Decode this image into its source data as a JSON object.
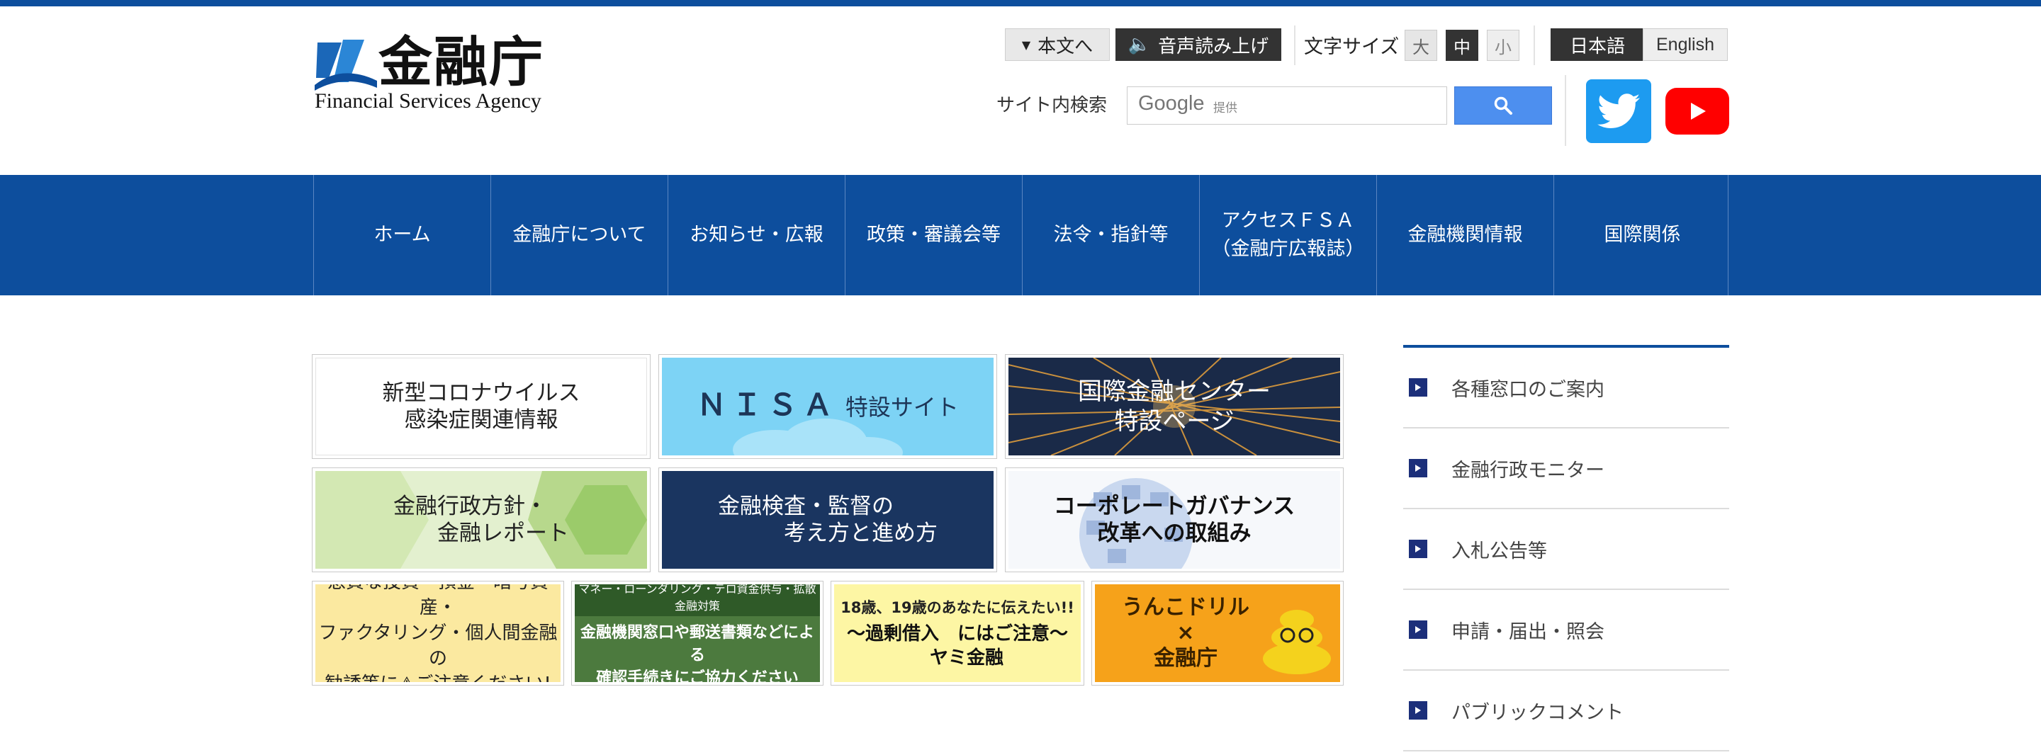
{
  "header": {
    "logo_jp": "金融庁",
    "logo_en": "Financial Services Agency",
    "honbun_label": "本文へ",
    "voice_label": "音声読み上げ",
    "font_size_label": "文字サイズ",
    "font_sizes": [
      "大",
      "中",
      "小"
    ],
    "lang_ja": "日本語",
    "lang_en": "English",
    "search_label": "サイト内検索",
    "search_provider": "Google",
    "search_provider_suffix": "提供"
  },
  "nav": [
    {
      "label": "ホーム"
    },
    {
      "label": "金融庁について"
    },
    {
      "label": "お知らせ・広報"
    },
    {
      "label": "政策・審議会等"
    },
    {
      "label": "法令・指針等"
    },
    {
      "label": "アクセスＦＳＡ\n（金融庁広報誌）"
    },
    {
      "label": "金融機関情報"
    },
    {
      "label": "国際関係"
    }
  ],
  "banners": {
    "corona": "新型コロナウイルス\n感染症関連情報",
    "nisa_main": "ＮＩＳＡ",
    "nisa_sub": "特設サイト",
    "intl_center": "国際金融センター\n特設ページ",
    "policy": "金融行政方針・\n　　金融レポート",
    "inspection": "金融検査・監督の\n　　　考え方と進め方",
    "governance": "コーポレートガバナンス\n改革への取組み",
    "scam": "悪質な投資・預金・暗号資産・\nファクタリング・個人間金融の\n勧誘等に⚠ご注意ください!",
    "aml_top": "マネー・ローンダリング・テロ資金供与・拡散金融対策",
    "aml_main": "金融機関窓口や郵送書類などによる\n確認手続きにご協力ください",
    "youth_top": "18歳、19歳のあなたに伝えたい!!",
    "youth_main": "〜過剰借入　にはご注意〜\n　ヤミ金融",
    "unko": "うんこドリル\n×\n金融庁"
  },
  "side": [
    {
      "label": "各種窓口のご案内"
    },
    {
      "label": "金融行政モニター"
    },
    {
      "label": "入札公告等"
    },
    {
      "label": "申請・届出・照会"
    },
    {
      "label": "パブリックコメント"
    }
  ],
  "colors": {
    "brand_blue": "#0d4e9d",
    "twitter": "#1d9bf0",
    "youtube": "#ff0000",
    "search_button": "#4d8fef"
  }
}
